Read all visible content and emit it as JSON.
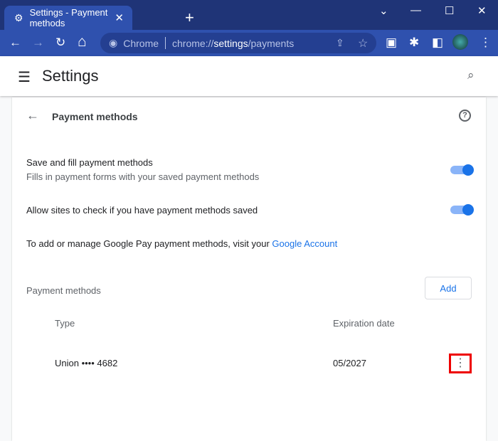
{
  "tab": {
    "title": "Settings - Payment methods",
    "close": "✕",
    "new": "+"
  },
  "window": {
    "dropdown": "⌄",
    "minimize": "—",
    "maximize": "☐",
    "close": "✕"
  },
  "toolbar": {
    "back": "←",
    "forward": "→",
    "reload": "↻",
    "home": "⌂",
    "site_label": "Chrome",
    "url_prefix": "chrome://",
    "url_host": "settings",
    "url_path": "/payments",
    "share": "⇪",
    "star": "☆",
    "ext1": "▣",
    "ext2": "✱",
    "sidepanel": "◧",
    "menu": "⋮"
  },
  "header": {
    "menu": "☰",
    "title": "Settings",
    "search": "⌕"
  },
  "page": {
    "back": "←",
    "title": "Payment methods",
    "help": "?",
    "save_fill": {
      "label": "Save and fill payment methods",
      "desc": "Fills in payment forms with your saved payment methods",
      "enabled": true
    },
    "allow_check": {
      "label": "Allow sites to check if you have payment methods saved",
      "enabled": true
    },
    "gpay_text": "To add or manage Google Pay payment methods, visit your ",
    "gpay_link": "Google Account",
    "section": "Payment methods",
    "add": "Add",
    "columns": {
      "type": "Type",
      "expiration": "Expiration date"
    },
    "cards": [
      {
        "type": "Union •••• 4682",
        "expiration": "05/2027",
        "more": "⋮"
      }
    ]
  },
  "colors": {
    "accent": "#1a73e8",
    "frame": "#1f3477",
    "toolbar": "#2f51ae"
  }
}
